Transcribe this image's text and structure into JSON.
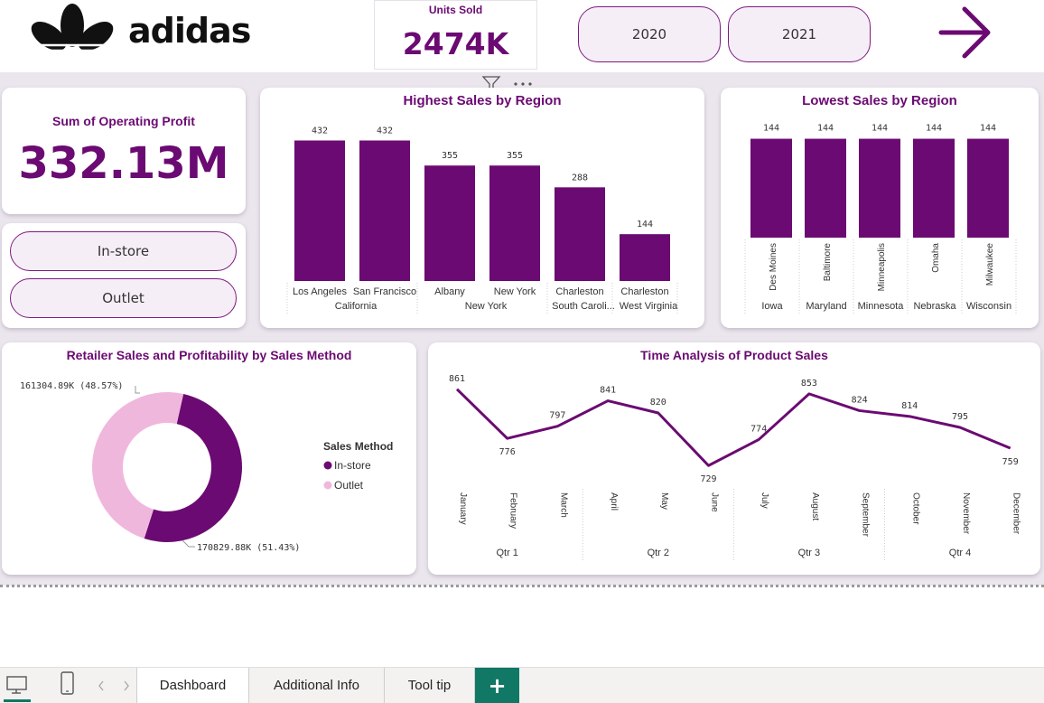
{
  "header": {
    "brand": "adidas",
    "units_sold_label": "Units Sold",
    "units_sold_value": "2474K",
    "year_buttons": [
      "2020",
      "2021"
    ],
    "next_icon": "arrow-right-icon"
  },
  "kpi_profit": {
    "label": "Sum of Operating Profit",
    "value": "332.13M"
  },
  "sales_method_buttons": [
    "In-store",
    "Outlet"
  ],
  "highest_sales": {
    "title": "Highest Sales by Region"
  },
  "lowest_sales": {
    "title": "Lowest Sales by Region"
  },
  "donut": {
    "title": "Retailer Sales and Profitability by Sales Method"
  },
  "time_analysis": {
    "title": "Time Analysis of Product Sales"
  },
  "tabs": {
    "items": [
      "Dashboard",
      "Additional Info",
      "Tool tip"
    ],
    "add_label": "+"
  },
  "colors": {
    "accent": "#6b0a72",
    "outlet_pink": "#f0b7dd",
    "tab_green": "#117865"
  },
  "chart_data": [
    {
      "type": "bar",
      "title": "Highest Sales by Region",
      "categories": [
        "Los Angeles",
        "San Francisco",
        "Albany",
        "New York",
        "Charleston",
        "Charleston"
      ],
      "groups": [
        {
          "name": "California",
          "count": 2
        },
        {
          "name": "New York",
          "count": 2
        },
        {
          "name": "South Carolina",
          "label": "South Caroli...",
          "count": 1
        },
        {
          "name": "West Virginia",
          "count": 1
        }
      ],
      "values": [
        432,
        432,
        355,
        355,
        288,
        144
      ],
      "ylim": [
        0,
        450
      ]
    },
    {
      "type": "bar",
      "title": "Lowest Sales by Region",
      "categories": [
        "Des Moines",
        "Baltimore",
        "Minneapolis",
        "Omaha",
        "Milwaukee"
      ],
      "groups": [
        "Iowa",
        "Maryland",
        "Minnesota",
        "Nebraska",
        "Wisconsin"
      ],
      "values": [
        144,
        144,
        144,
        144,
        144
      ],
      "ylim": [
        0,
        150
      ]
    },
    {
      "type": "pie",
      "title": "Retailer Sales and Profitability by Sales Method",
      "legend_title": "Sales Method",
      "series": [
        {
          "name": "In-store",
          "value": 170829.88,
          "label": "170829.88K (51.43%)",
          "color": "#6b0a72"
        },
        {
          "name": "Outlet",
          "value": 161304.89,
          "label": "161304.89K (48.57%)",
          "color": "#f0b7dd"
        }
      ]
    },
    {
      "type": "line",
      "title": "Time Analysis of Product Sales",
      "categories": [
        "January",
        "February",
        "March",
        "April",
        "May",
        "June",
        "July",
        "August",
        "September",
        "October",
        "November",
        "December"
      ],
      "quarters": [
        "Qtr 1",
        "Qtr 2",
        "Qtr 3",
        "Qtr 4"
      ],
      "values": [
        861,
        776,
        797,
        841,
        820,
        729,
        774,
        853,
        824,
        814,
        795,
        759
      ],
      "ylim": [
        720,
        870
      ]
    }
  ]
}
